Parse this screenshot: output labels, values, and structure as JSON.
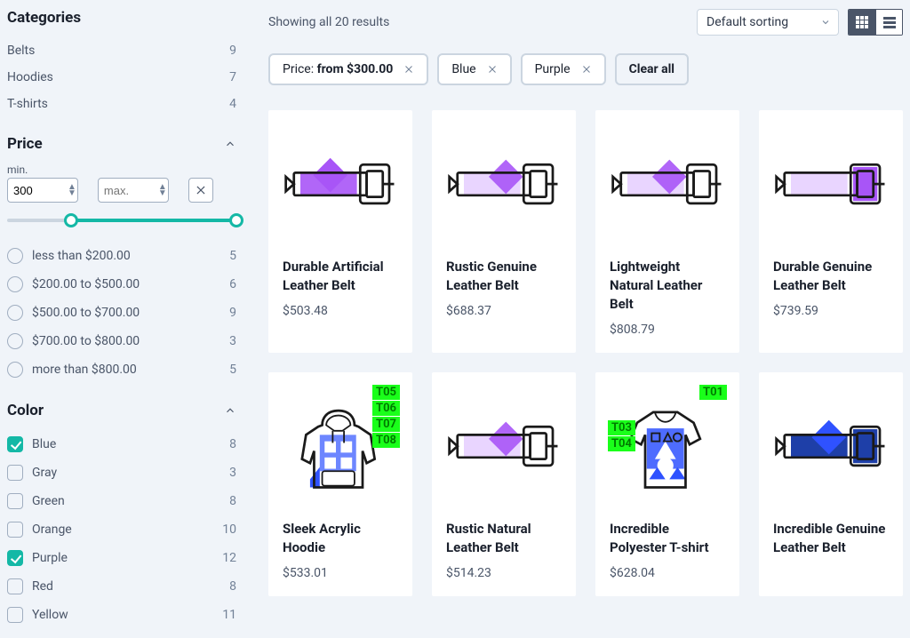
{
  "sidebar": {
    "categories_title": "Categories",
    "categories": [
      {
        "name": "Belts",
        "count": "9"
      },
      {
        "name": "Hoodies",
        "count": "7"
      },
      {
        "name": "T-shirts",
        "count": "4"
      }
    ],
    "price_title": "Price",
    "price_min_label": "min.",
    "price_min_value": "300",
    "price_max_placeholder": "max.",
    "price_ranges": [
      {
        "label": "less than $200.00",
        "count": "5"
      },
      {
        "label": "$200.00 to $500.00",
        "count": "6"
      },
      {
        "label": "$500.00 to $700.00",
        "count": "9"
      },
      {
        "label": "$700.00 to $800.00",
        "count": "3"
      },
      {
        "label": "more than $800.00",
        "count": "5"
      }
    ],
    "color_title": "Color",
    "colors": [
      {
        "label": "Blue",
        "count": "8",
        "checked": true
      },
      {
        "label": "Gray",
        "count": "3",
        "checked": false
      },
      {
        "label": "Green",
        "count": "8",
        "checked": false
      },
      {
        "label": "Orange",
        "count": "10",
        "checked": false
      },
      {
        "label": "Purple",
        "count": "12",
        "checked": true
      },
      {
        "label": "Red",
        "count": "8",
        "checked": false
      },
      {
        "label": "Yellow",
        "count": "11",
        "checked": false
      }
    ]
  },
  "main": {
    "result_text": "Showing all 20 results",
    "sort_label": "Default sorting",
    "chips": {
      "price_prefix": "Price: ",
      "price_value": "from $300.00",
      "blue": "Blue",
      "purple": "Purple",
      "clear": "Clear all"
    },
    "products": [
      {
        "title": "Durable Artificial Leather Belt",
        "price": "$503.48",
        "img": "belt-purple",
        "tags_r": [],
        "tags_l": []
      },
      {
        "title": "Rustic Genuine Leather Belt",
        "price": "$688.37",
        "img": "belt-purple-light",
        "tags_r": [],
        "tags_l": []
      },
      {
        "title": "Lightweight Natural Leather Belt",
        "price": "$808.79",
        "img": "belt-purple-light",
        "tags_r": [],
        "tags_l": []
      },
      {
        "title": "Durable Genuine Leather Belt",
        "price": "$739.59",
        "img": "belt-purple-solid",
        "tags_r": [],
        "tags_l": []
      },
      {
        "title": "Sleek Acrylic Hoodie",
        "price": "$533.01",
        "img": "hoodie-blue",
        "tags_r": [
          "T05",
          "T06",
          "T07",
          "T08"
        ],
        "tags_l": []
      },
      {
        "title": "Rustic Natural Leather Belt",
        "price": "$514.23",
        "img": "belt-purple-light",
        "tags_r": [],
        "tags_l": []
      },
      {
        "title": "Incredible Polyester T-shirt",
        "price": "$628.04",
        "img": "tshirt-blue",
        "tags_r": [
          "T01"
        ],
        "tags_l": [
          "T03",
          "T04"
        ]
      },
      {
        "title": "Incredible Genuine Leather Belt",
        "price": "",
        "img": "belt-blue",
        "tags_r": [],
        "tags_l": []
      }
    ]
  },
  "colors": {
    "purple": "#a855f7",
    "purple_light": "#e9d5ff",
    "blue": "#2f52ff",
    "blue_dark": "#1e3fa8"
  }
}
